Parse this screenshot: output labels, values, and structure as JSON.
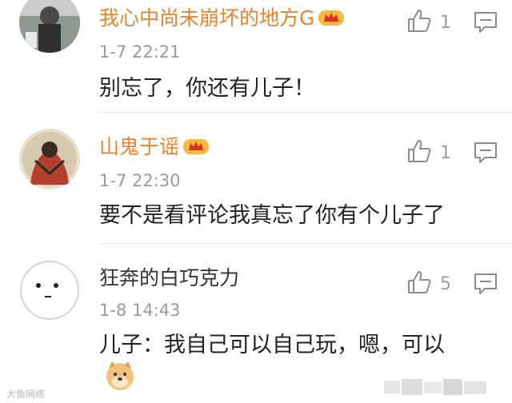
{
  "comments": [
    {
      "username": "我心中尚未崩坏的地方G",
      "time": "1-7 22:21",
      "text": "别忘了，你还有儿子！",
      "likes": "1",
      "username_color": "#e8822d"
    },
    {
      "username": "山鬼于谣",
      "time": "1-7 22:30",
      "text": "要不是看评论我真忘了你有个儿子了",
      "likes": "1",
      "username_color": "#e8822d"
    },
    {
      "username": "狂奔的白巧克力",
      "time": "1-8 14:43",
      "text": "儿子：我自己可以自己玩，嗯，可以",
      "likes": "5",
      "username_color": "#333333"
    }
  ],
  "watermark": "大鱼网络",
  "icons": {
    "like": "thumbs-up-icon",
    "reply": "comment-icon",
    "vip": "vip-crown-icon",
    "emoji": "doge-emoji-icon"
  }
}
